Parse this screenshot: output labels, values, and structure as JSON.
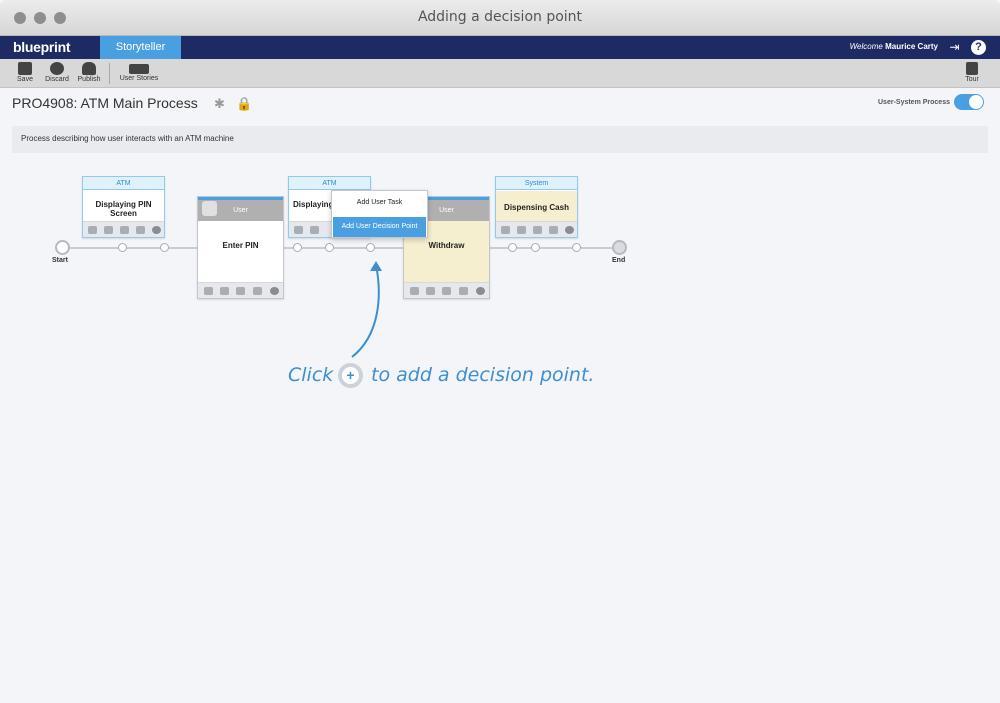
{
  "window": {
    "title": "Adding a decision point"
  },
  "navbar": {
    "logo": "blueprint",
    "active_tab": "Storyteller",
    "welcome_prefix": "Welcome",
    "user_name": "Maurice Carty"
  },
  "toolbar": {
    "save_label": "Save",
    "discard_label": "Discard",
    "publish_label": "Publish",
    "user_stories_label": "User Stories",
    "tour_label": "Tour"
  },
  "header": {
    "title": "PRO4908: ATM Main Process",
    "toggle_label": "User-System Process"
  },
  "description": "Process describing how user interacts with an ATM machine",
  "diagram": {
    "start_label": "Start",
    "end_label": "End",
    "cards": [
      {
        "type": "system",
        "header": "ATM",
        "title": "Displaying PIN Screen"
      },
      {
        "type": "user",
        "header": "User",
        "title": "Enter PIN"
      },
      {
        "type": "system",
        "header": "ATM",
        "title": "Displaying Pa"
      },
      {
        "type": "user",
        "header": "User",
        "title": "Withdraw"
      },
      {
        "type": "system",
        "header": "System",
        "title": "Dispensing Cash"
      }
    ]
  },
  "context_menu": {
    "items": [
      "Add User Task",
      "Add User Decision Point"
    ],
    "selected": "Add User Decision Point"
  },
  "annotation": {
    "before": "Click",
    "after": "to add a decision point."
  },
  "colors": {
    "accent": "#4a9fe0",
    "navbar": "#1d2a64"
  }
}
